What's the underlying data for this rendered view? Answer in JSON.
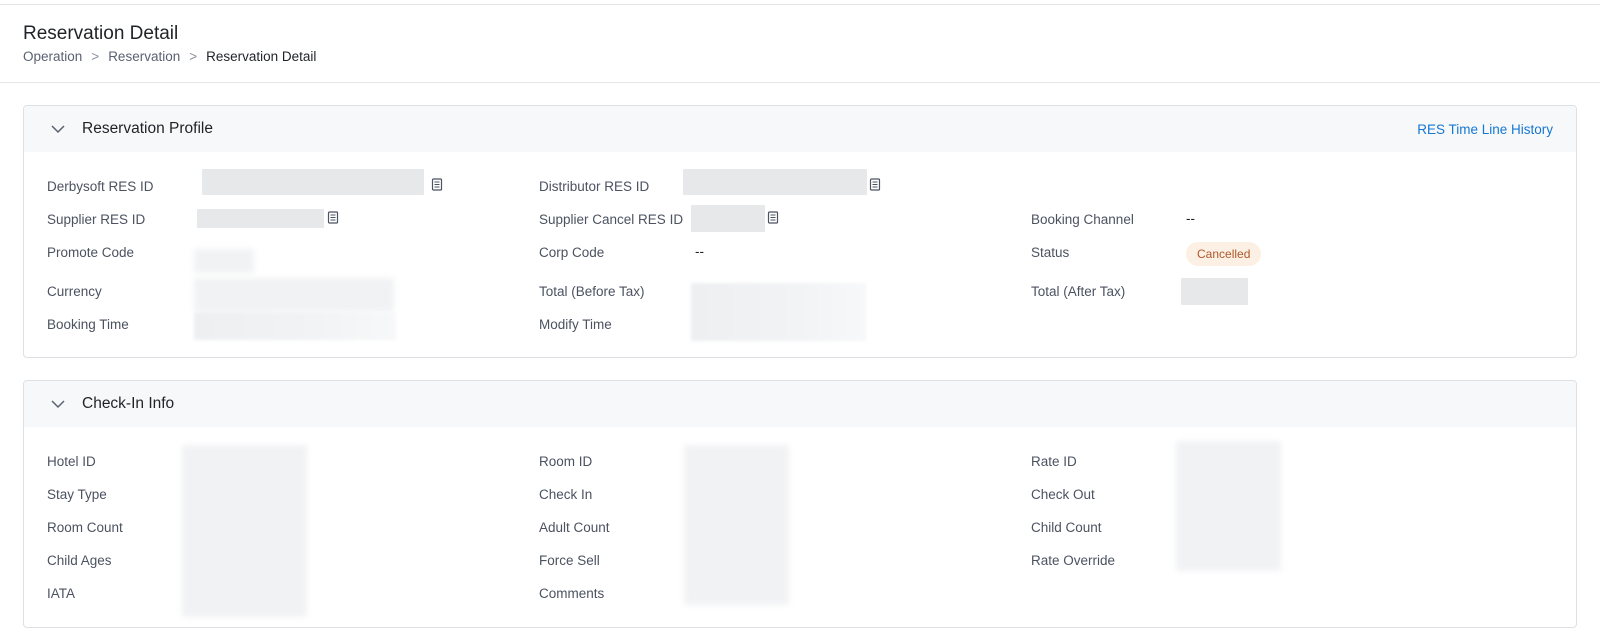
{
  "page": {
    "title": "Reservation Detail",
    "breadcrumb": [
      "Operation",
      "Reservation",
      "Reservation Detail"
    ],
    "breadcrumb_separator": ">"
  },
  "profile": {
    "title": "Reservation Profile",
    "history_link": "RES Time Line History",
    "labels": {
      "derbysoft_res_id": "Derbysoft RES ID",
      "distributor_res_id": "Distributor RES ID",
      "supplier_res_id": "Supplier RES ID",
      "supplier_cancel_res_id": "Supplier Cancel RES ID",
      "booking_channel": "Booking Channel",
      "promote_code": "Promote Code",
      "corp_code": "Corp Code",
      "status": "Status",
      "currency": "Currency",
      "total_before_tax": "Total (Before Tax)",
      "total_after_tax": "Total (After Tax)",
      "booking_time": "Booking Time",
      "modify_time": "Modify Time"
    },
    "values": {
      "booking_channel": "--",
      "corp_code": "--",
      "status": "Cancelled"
    }
  },
  "checkin": {
    "title": "Check-In Info",
    "labels": {
      "hotel_id": "Hotel ID",
      "room_id": "Room ID",
      "rate_id": "Rate ID",
      "stay_type": "Stay Type",
      "check_in": "Check In",
      "check_out": "Check Out",
      "room_count": "Room Count",
      "adult_count": "Adult Count",
      "child_count": "Child Count",
      "child_ages": "Child Ages",
      "force_sell": "Force Sell",
      "rate_override": "Rate Override",
      "iata": "IATA",
      "comments": "Comments"
    }
  },
  "icons": {
    "collapse": "chevron-down-icon",
    "copy": "copy-icon"
  },
  "colors": {
    "link": "#1677d2",
    "status_cancelled_bg": "#fcefe4",
    "status_cancelled_text": "#b0592a"
  }
}
